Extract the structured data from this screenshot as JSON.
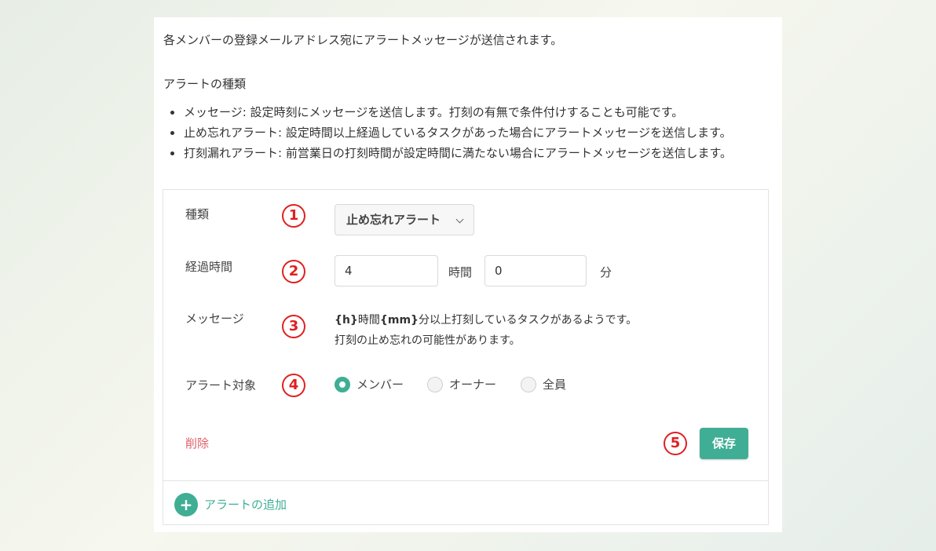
{
  "intro": "各メンバーの登録メールアドレス宛にアラートメッセージが送信されます。",
  "types_heading": "アラートの種類",
  "types": [
    "メッセージ: 設定時刻にメッセージを送信します。打刻の有無で条件付けすることも可能です。",
    "止め忘れアラート: 設定時間以上経過しているタスクがあった場合にアラートメッセージを送信します。",
    "打刻漏れアラート: 前営業日の打刻時間が設定時間に満たない場合にアラートメッセージを送信します。"
  ],
  "form": {
    "type": {
      "label": "種類",
      "step": "1",
      "value": "止め忘れアラート",
      "chevron_icon": "chevron-down-icon"
    },
    "elapsed": {
      "label": "経過時間",
      "step": "2",
      "hours_value": "4",
      "hours_unit": "時間",
      "minutes_value": "0",
      "minutes_unit": "分"
    },
    "message": {
      "label": "メッセージ",
      "step": "3",
      "line1_prefix": "{h}",
      "line1_mid1": "時間",
      "line1_code": "{mm}",
      "line1_rest": "分以上打刻しているタスクがあるようです。",
      "line2": "打刻の止め忘れの可能性があります。"
    },
    "target": {
      "label": "アラート対象",
      "step": "4",
      "options": [
        "メンバー",
        "オーナー",
        "全員"
      ],
      "selected": "メンバー"
    },
    "delete_label": "削除",
    "save_step": "5",
    "save_label": "保存"
  },
  "add_alert": {
    "label": "アラートの追加",
    "icon": "plus-circle-icon"
  },
  "colors": {
    "accent": "#3fae94",
    "danger": "#e0606a",
    "annotation": "#e02020"
  }
}
